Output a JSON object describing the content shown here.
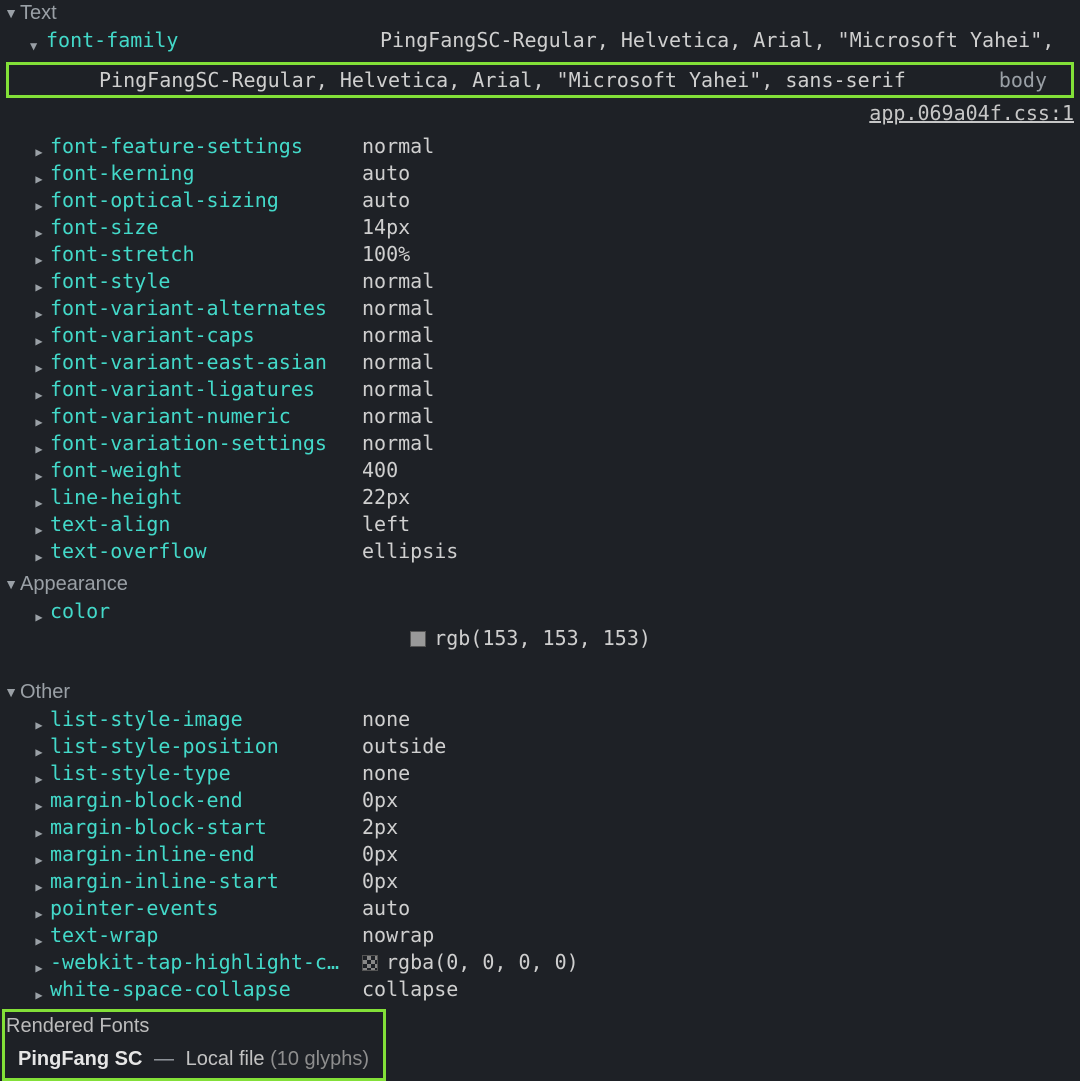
{
  "groups": {
    "text": "Text",
    "appearance": "Appearance",
    "other": "Other"
  },
  "fontFamily": {
    "prop": "font-family",
    "value": "PingFangSC-Regular, Helvetica, Arial, \"Microsoft Yahei\",",
    "expandedValue": "PingFangSC-Regular, Helvetica, Arial, \"Microsoft Yahei\", sans-serif",
    "selector": "body",
    "source": "app.069a04f.css:1"
  },
  "text": [
    {
      "prop": "font-feature-settings",
      "val": "normal"
    },
    {
      "prop": "font-kerning",
      "val": "auto"
    },
    {
      "prop": "font-optical-sizing",
      "val": "auto"
    },
    {
      "prop": "font-size",
      "val": "14px"
    },
    {
      "prop": "font-stretch",
      "val": "100%"
    },
    {
      "prop": "font-style",
      "val": "normal"
    },
    {
      "prop": "font-variant-alternates",
      "val": "normal"
    },
    {
      "prop": "font-variant-caps",
      "val": "normal"
    },
    {
      "prop": "font-variant-east-asian",
      "val": "normal"
    },
    {
      "prop": "font-variant-ligatures",
      "val": "normal"
    },
    {
      "prop": "font-variant-numeric",
      "val": "normal"
    },
    {
      "prop": "font-variation-settings",
      "val": "normal"
    },
    {
      "prop": "font-weight",
      "val": "400"
    },
    {
      "prop": "line-height",
      "val": "22px"
    },
    {
      "prop": "text-align",
      "val": "left"
    },
    {
      "prop": "text-overflow",
      "val": "ellipsis"
    }
  ],
  "appearance": {
    "prop": "color",
    "swatch": "#999999",
    "val": "rgb(153, 153, 153)"
  },
  "other": [
    {
      "prop": "list-style-image",
      "val": "none"
    },
    {
      "prop": "list-style-position",
      "val": "outside"
    },
    {
      "prop": "list-style-type",
      "val": "none"
    },
    {
      "prop": "margin-block-end",
      "val": "0px"
    },
    {
      "prop": "margin-block-start",
      "val": "2px"
    },
    {
      "prop": "margin-inline-end",
      "val": "0px"
    },
    {
      "prop": "margin-inline-start",
      "val": "0px"
    },
    {
      "prop": "pointer-events",
      "val": "auto"
    },
    {
      "prop": "text-wrap",
      "val": "nowrap"
    },
    {
      "prop": "-webkit-tap-highlight-c…",
      "val": "rgba(0, 0, 0, 0)",
      "swatch": "checker"
    },
    {
      "prop": "white-space-collapse",
      "val": "collapse"
    }
  ],
  "renderedFonts": {
    "title": "Rendered Fonts",
    "name": "PingFang SC",
    "dash": "—",
    "location": "Local file",
    "glyphs": "(10 glyphs)"
  }
}
